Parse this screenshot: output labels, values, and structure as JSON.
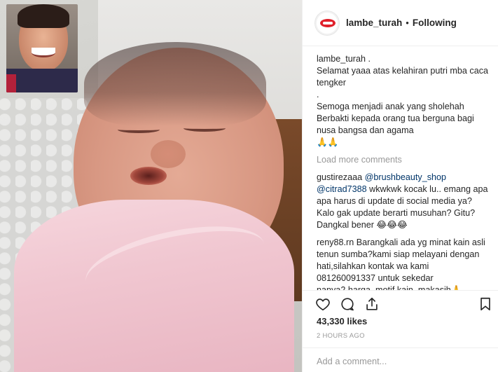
{
  "header": {
    "username": "lambe_turah",
    "separator": "•",
    "follow_status": "Following"
  },
  "caption": {
    "username": "lambe_turah .",
    "lines": [
      "Selamat yaaa atas kelahiran putri mba caca",
      "tengker",
      ".",
      "Semoga menjadi anak yang sholehah",
      "Berbakti kepada orang tua berguna bagi",
      "nusa bangsa dan agama",
      "🙏🙏"
    ]
  },
  "load_more": "Load more comments",
  "comments": [
    {
      "username": "gustirezaaa",
      "mention1": "@brushbeauty_shop",
      "mention2": "@citrad7388",
      "line2_rest": " wkwkwk kocak lu.. emang apa",
      "lines": [
        "apa harus di update di social media ya?",
        "Kalo gak update berarti musuhan? Gitu?",
        "Dangkal bener 😂😂😂"
      ]
    },
    {
      "username": "reny88.rn",
      "first_rest": " Barangkali ada yg minat kain asli",
      "lines": [
        "tenun sumba?kami siap melayani dengan",
        "hati,silahkan kontak wa kami",
        "081260091337 untuk sekedar",
        "nanya2,harga,,motif kain..makasih🙏"
      ]
    }
  ],
  "actions": {
    "like_icon": "heart-icon",
    "comment_icon": "comment-icon",
    "share_icon": "share-icon",
    "save_icon": "bookmark-icon"
  },
  "likes": "43,330 likes",
  "timestamp": "2 HOURS AGO",
  "add_comment": {
    "placeholder": "Add a comment..."
  },
  "colors": {
    "text": "#262626",
    "muted": "#999999",
    "link": "#003569",
    "border": "#efefef",
    "logo_red": "#e0202a"
  }
}
